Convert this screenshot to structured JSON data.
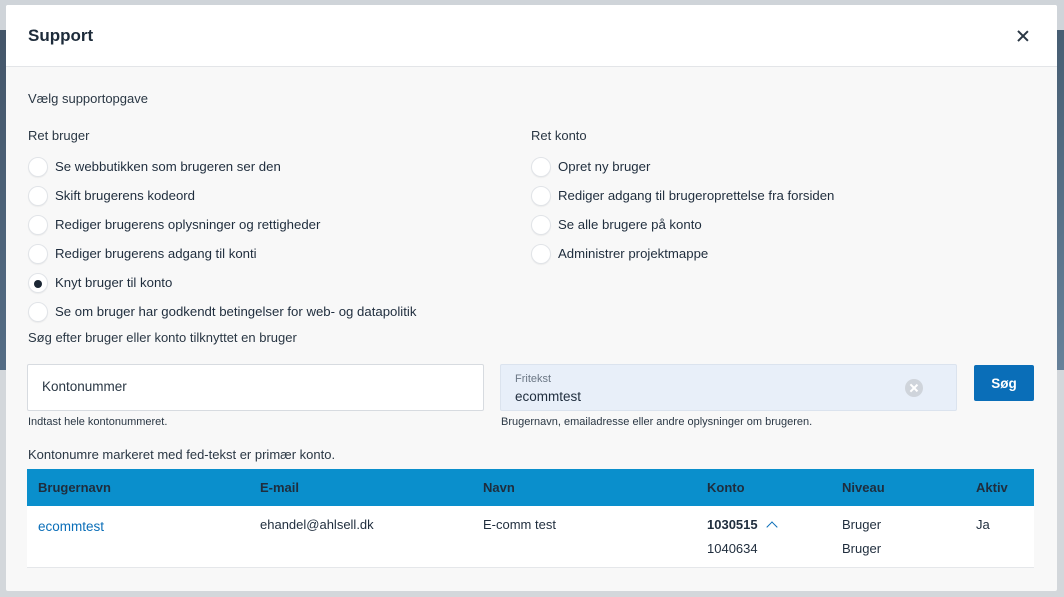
{
  "modal": {
    "title": "Support",
    "section_label": "Vælg supportopgave"
  },
  "left_column": {
    "heading": "Ret bruger",
    "options": [
      {
        "label": "Se webbutikken som brugeren ser den",
        "checked": false
      },
      {
        "label": "Skift brugerens kodeord",
        "checked": false
      },
      {
        "label": "Rediger brugerens oplysninger og rettigheder",
        "checked": false
      },
      {
        "label": "Rediger brugerens adgang til konti",
        "checked": false
      },
      {
        "label": "Knyt bruger til konto",
        "checked": true
      },
      {
        "label": "Se om bruger har godkendt betingelser for web- og datapolitik",
        "checked": false
      }
    ]
  },
  "right_column": {
    "heading": "Ret konto",
    "options": [
      {
        "label": "Opret ny bruger",
        "checked": false
      },
      {
        "label": "Rediger adgang til brugeroprettelse fra forsiden",
        "checked": false
      },
      {
        "label": "Se alle brugere på konto",
        "checked": false
      },
      {
        "label": "Administrer projektmappe",
        "checked": false
      }
    ]
  },
  "search": {
    "label": "Søg efter bruger eller konto tilknyttet en bruger",
    "konto_placeholder": "Kontonummer",
    "konto_helper": "Indtast hele kontonummeret.",
    "fritekst_label": "Fritekst",
    "fritekst_value": "ecommtest",
    "fritekst_helper": "Brugernavn, emailadresse eller andre oplysninger om brugeren.",
    "button_label": "Søg"
  },
  "results": {
    "note": "Kontonumre markeret med fed-tekst er primær konto.",
    "headers": [
      "Brugernavn",
      "E-mail",
      "Navn",
      "Konto",
      "Niveau",
      "Aktiv"
    ],
    "rows": [
      {
        "username": "ecommtest",
        "email": "ehandel@ahlsell.dk",
        "name": "E-comm test",
        "primary_account": "1030515",
        "secondary_account": "1040634",
        "level_1": "Bruger",
        "level_2": "Bruger",
        "active": "Ja"
      }
    ]
  },
  "colors": {
    "accent": "#0a6eb8",
    "table_header": "#0a8fcc"
  }
}
